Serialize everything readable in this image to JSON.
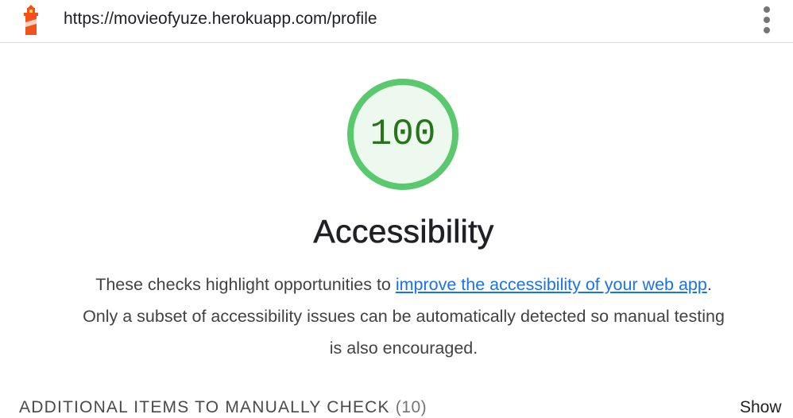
{
  "topbar": {
    "logo_icon": "lighthouse-icon",
    "url": "https://movieofyuze.herokuapp.com/profile",
    "menu_icon": "vertical-dots-icon"
  },
  "score": {
    "value": "100",
    "fraction": 1.0,
    "ring_color": "#5ac96e",
    "fill_color": "#edf8ee",
    "text_color": "#28741a"
  },
  "category": {
    "title": "Accessibility",
    "description_before": "These checks highlight opportunities to ",
    "link_text": "improve the accessibility of your web app",
    "description_after": ". Only a subset of accessibility issues can be automatically detected so manual testing is also encouraged."
  },
  "manual_section": {
    "title": "ADDITIONAL ITEMS TO MANUALLY CHECK",
    "count": "(10)",
    "toggle_label": "Show"
  },
  "colors": {
    "link": "#1a73e8",
    "pass_green": "#5ac96e"
  }
}
